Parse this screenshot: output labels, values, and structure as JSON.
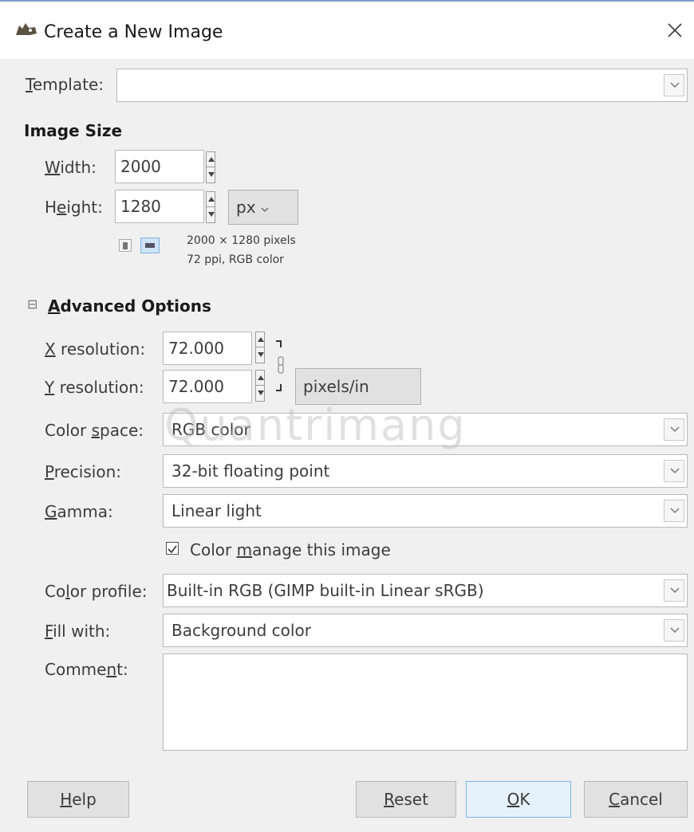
{
  "window": {
    "title": "Create a New Image",
    "icon": "gimp-wilber-icon"
  },
  "template": {
    "label_first": "T",
    "label_rest": "emplate:",
    "value": ""
  },
  "image_size": {
    "heading": "Image Size",
    "width_label_first": "W",
    "width_label_rest": "idth:",
    "width_value": "2000",
    "height_label_a": "H",
    "height_label_u": "e",
    "height_label_b": "ight:",
    "height_value": "1280",
    "unit": "px",
    "info_line1": "2000 × 1280 pixels",
    "info_line2": "72 ppi, RGB color"
  },
  "advanced": {
    "heading_first": "A",
    "heading_rest": "dvanced Options",
    "expander_symbol": "⊟",
    "x_res_label_first": "X",
    "x_res_label_rest": " resolution:",
    "x_res_value": "72.000",
    "y_res_label_first": "Y",
    "y_res_label_rest": " resolution:",
    "y_res_value": "72.000",
    "res_unit": "pixels/in",
    "color_space_label_a": "Color ",
    "color_space_label_u": "s",
    "color_space_label_b": "pace:",
    "color_space_value": "RGB color",
    "precision_label_first": "P",
    "precision_label_rest": "recision:",
    "precision_value": "32-bit floating point",
    "gamma_label_first": "G",
    "gamma_label_rest": "amma:",
    "gamma_value": "Linear light",
    "color_manage_checked": true,
    "color_manage_a": "Color ",
    "color_manage_u": "m",
    "color_manage_b": "anage this image",
    "color_profile_label_a": "Co",
    "color_profile_label_u": "l",
    "color_profile_label_b": "or profile:",
    "color_profile_value": "Built-in RGB (GIMP built-in Linear sRGB)",
    "fill_label_first": "F",
    "fill_label_rest": "ill with:",
    "fill_value": "Background color",
    "comment_label_a": "Comme",
    "comment_label_u": "n",
    "comment_label_b": "t:",
    "comment_value": ""
  },
  "buttons": {
    "help_first": "H",
    "help_rest": "elp",
    "reset_first": "R",
    "reset_rest": "eset",
    "ok_first": "O",
    "ok_rest": "K",
    "cancel_first": "C",
    "cancel_rest": "ancel"
  },
  "watermark": "Quantrimang",
  "colors": {
    "window_bg": "#f0f0f0",
    "title_bar": "#ffffff",
    "ok_button_border": "#7fb3e6",
    "unit_button_bg": "#e1e1e1"
  }
}
